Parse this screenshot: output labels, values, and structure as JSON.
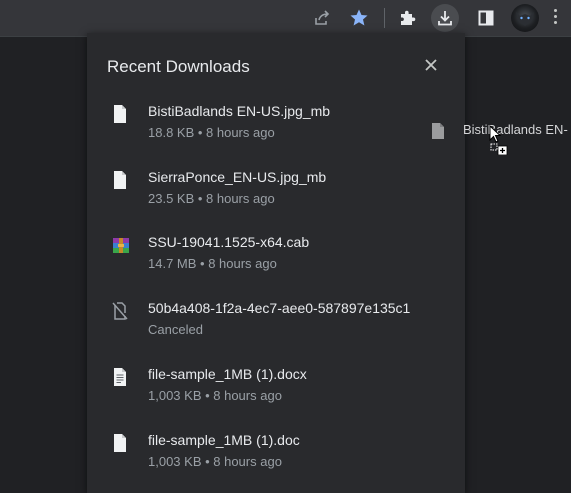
{
  "panel": {
    "title": "Recent Downloads"
  },
  "downloads": [
    {
      "name": "BistiBadlands EN-US.jpg_mb",
      "meta": "18.8 KB • 8 hours ago",
      "icon": "file-icon"
    },
    {
      "name": "SierraPonce_EN-US.jpg_mb",
      "meta": "23.5 KB • 8 hours ago",
      "icon": "file-icon"
    },
    {
      "name": "SSU-19041.1525-x64.cab",
      "meta": "14.7 MB • 8 hours ago",
      "icon": "archive-icon"
    },
    {
      "name": "50b4a408-1f2a-4ec7-aee0-587897e135c1",
      "meta": "Canceled",
      "icon": "file-canceled-icon"
    },
    {
      "name": "file-sample_1MB (1).docx",
      "meta": "1,003 KB • 8 hours ago",
      "icon": "document-icon"
    },
    {
      "name": "file-sample_1MB (1).doc",
      "meta": "1,003 KB • 8 hours ago",
      "icon": "file-icon"
    }
  ],
  "drag": {
    "label": "BistiBadlands EN-"
  },
  "toolbar": {
    "icons": [
      "share-icon",
      "bookmark-star-icon",
      "extensions-puzzle-icon",
      "download-icon",
      "side-panel-icon",
      "profile-avatar",
      "menu-dots-icon"
    ],
    "star_color": "#8ab4f8"
  }
}
